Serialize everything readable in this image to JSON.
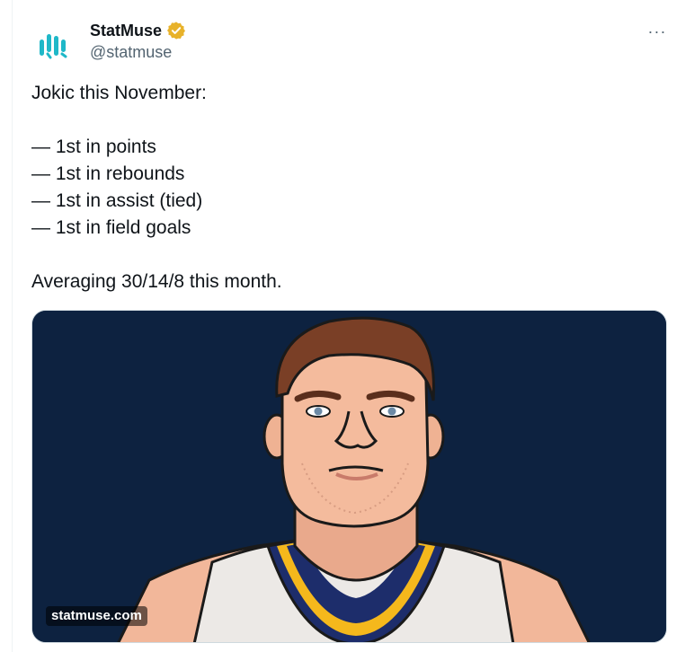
{
  "author": {
    "display_name": "StatMuse",
    "handle": "@statmuse",
    "verified": true,
    "avatar_icon": "statmuse-logo-icon"
  },
  "menu": {
    "more_label": "···"
  },
  "tweet": {
    "lines": [
      "Jokic this November:",
      "",
      "— 1st in points",
      "— 1st in rebounds",
      "— 1st in assist (tied)",
      "— 1st in field goals",
      "",
      "Averaging 30/14/8 this month."
    ]
  },
  "media": {
    "watermark": "statmuse.com",
    "background_color": "#0d2240",
    "jersey_colors": {
      "base": "#ece9e6",
      "trim_gold": "#f5b81c",
      "trim_navy": "#1d2d6b"
    }
  },
  "colors": {
    "text_primary": "#0f1419",
    "text_secondary": "#536471",
    "verified_gold": "#e8b22a",
    "logo_teal": "#1fb8c8"
  }
}
